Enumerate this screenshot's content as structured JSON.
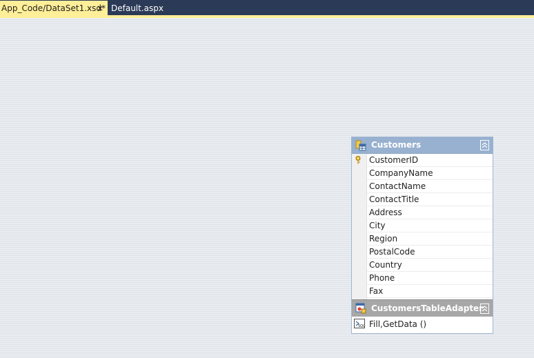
{
  "tabs": [
    {
      "label": "App_Code/DataSet1.xsd*",
      "active": true,
      "close_glyph": "×"
    },
    {
      "label": "Default.aspx",
      "active": false
    }
  ],
  "table": {
    "title": "Customers",
    "icon": "table-icon",
    "key_icon": "primary-key-icon",
    "collapse_glyph": "︽",
    "columns": [
      "CustomerID",
      "CompanyName",
      "ContactName",
      "ContactTitle",
      "Address",
      "City",
      "Region",
      "PostalCode",
      "Country",
      "Phone",
      "Fax"
    ]
  },
  "adapter": {
    "title": "CustomersTableAdapter",
    "icon": "table-adapter-icon",
    "query_icon": "sql-query-icon",
    "query": "Fill,GetData ()"
  },
  "colors": {
    "tabbar": "#2b3a56",
    "active_tab": "#ffef98",
    "table_header": "#98b1d0",
    "adapter_header": "#a7a7a7"
  }
}
